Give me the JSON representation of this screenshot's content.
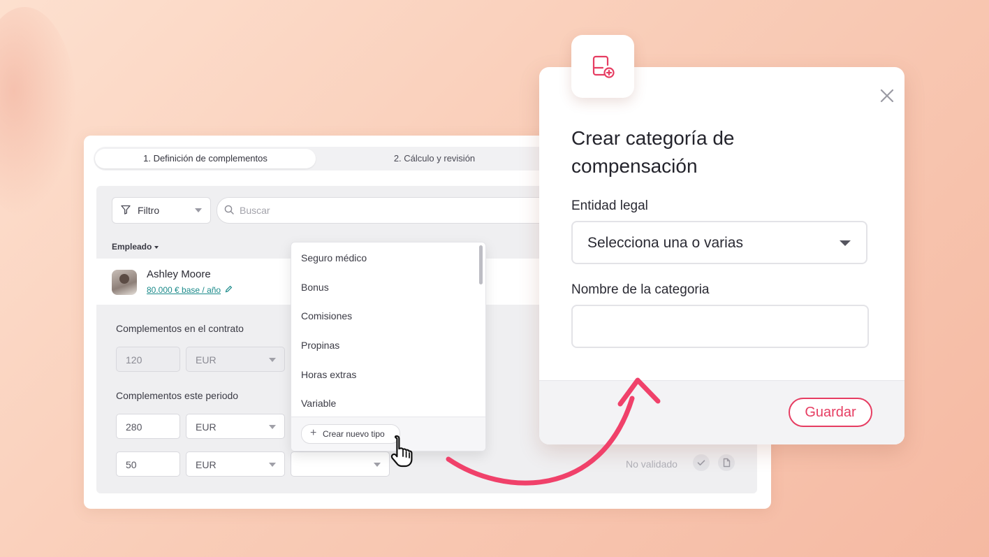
{
  "steps": {
    "step1": "1. Definición de complementos",
    "step2": "2. Cálculo y revisión"
  },
  "toolbar": {
    "filter_label": "Filtro",
    "search_placeholder": "Buscar"
  },
  "table": {
    "header_employee": "Empleado"
  },
  "employee": {
    "name": "Ashley Moore",
    "salary": "80.000 € base / año"
  },
  "contract_section": {
    "label": "Complementos en el contrato",
    "amount": "120",
    "currency": "EUR"
  },
  "period_section": {
    "label": "Complementos este periodo",
    "rows": [
      {
        "amount": "280",
        "currency": "EUR"
      },
      {
        "amount": "50",
        "currency": "EUR"
      }
    ]
  },
  "status": {
    "text": "No validado"
  },
  "type_dropdown": {
    "items": [
      "Seguro médico",
      "Bonus",
      "Comisiones",
      "Propinas",
      "Horas extras",
      "Variable"
    ],
    "create_label": "Crear nuevo tipo"
  },
  "modal": {
    "title": "Crear categoría de compensación",
    "legal_entity_label": "Entidad legal",
    "legal_entity_value": "Selecciona una o varias",
    "category_name_label": "Nombre de la categoria",
    "category_name_value": "",
    "save_label": "Guardar"
  },
  "colors": {
    "accent": "#e63d62",
    "link": "#1a8a8a",
    "arrow": "#f0416a"
  },
  "icons": [
    "filter-icon",
    "search-icon",
    "pencil-icon",
    "check-icon",
    "document-icon",
    "plus-icon",
    "hand-pointer-icon",
    "close-icon",
    "add-category-icon",
    "chevron-down-icon"
  ]
}
